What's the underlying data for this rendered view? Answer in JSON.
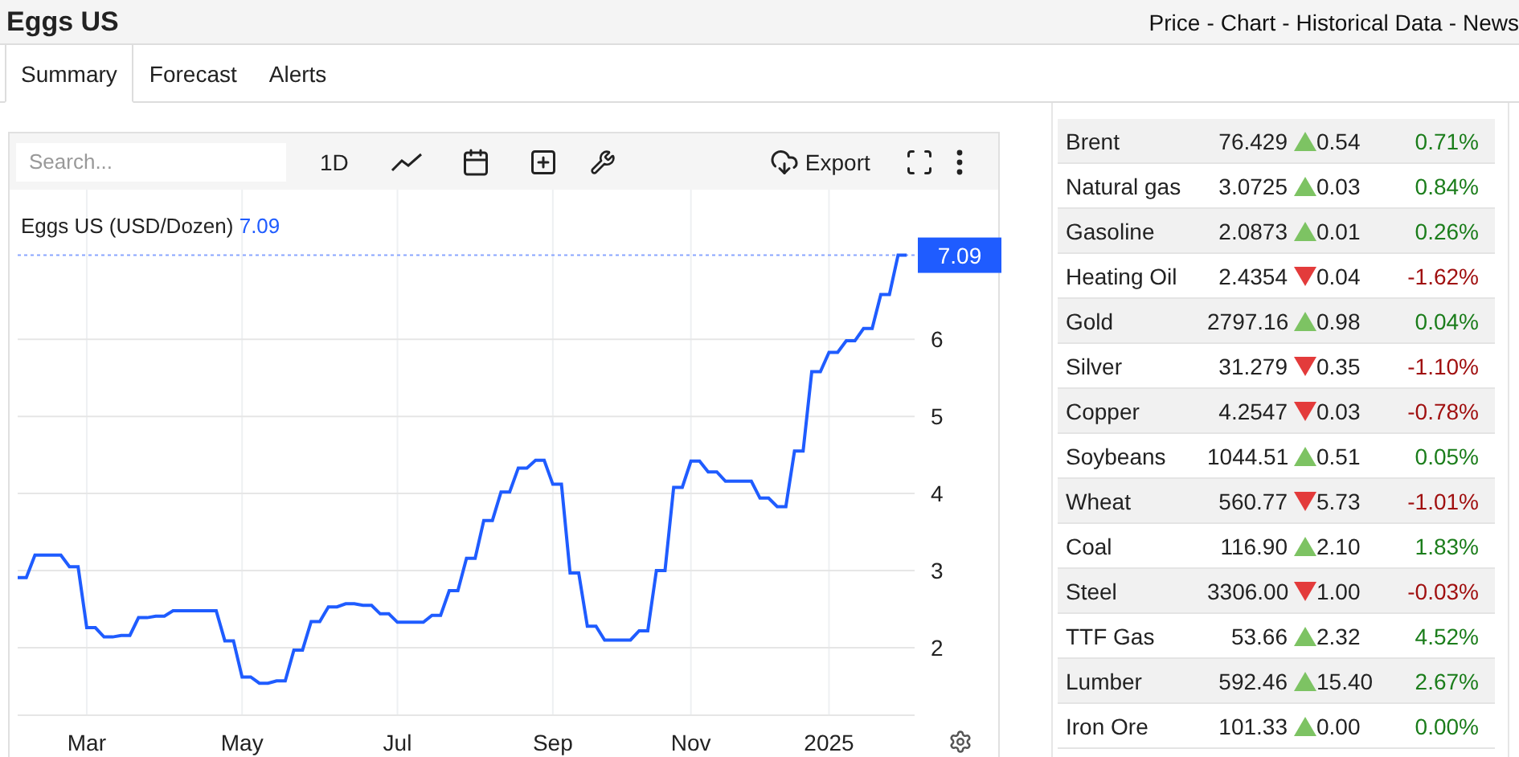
{
  "header": {
    "title": "Eggs US",
    "nav": [
      "Price",
      "Chart",
      "Historical Data",
      "News"
    ],
    "nav_separator": "-"
  },
  "tabs": [
    {
      "label": "Summary",
      "selected": true
    },
    {
      "label": "Forecast",
      "selected": false
    },
    {
      "label": "Alerts",
      "selected": false
    }
  ],
  "toolbar": {
    "search": {
      "placeholder": "Search..."
    },
    "interval": "1D",
    "export": "Export"
  },
  "chart": {
    "title": "Eggs US (USD/Dozen)",
    "title_value": "7.09",
    "last_value": "7.09",
    "chart_data": {
      "type": "line",
      "categories": [
        null,
        null,
        null,
        null,
        null,
        null,
        null,
        null,
        "Mar",
        null,
        null,
        null,
        null,
        null,
        null,
        null,
        null,
        null,
        null,
        null,
        null,
        null,
        null,
        null,
        null,
        null,
        "May",
        null,
        null,
        null,
        null,
        null,
        null,
        null,
        null,
        null,
        null,
        null,
        null,
        null,
        null,
        null,
        null,
        null,
        "Jul",
        null,
        null,
        null,
        null,
        null,
        null,
        null,
        null,
        null,
        null,
        null,
        null,
        null,
        null,
        null,
        null,
        null,
        "Sep",
        null,
        null,
        null,
        null,
        null,
        null,
        null,
        null,
        null,
        null,
        null,
        null,
        null,
        null,
        null,
        "Nov",
        null,
        null,
        null,
        null,
        null,
        null,
        null,
        null,
        null,
        null,
        null,
        null,
        null,
        null,
        null,
        "2025",
        null,
        null,
        null,
        null,
        null,
        null,
        null,
        null,
        null
      ],
      "series": [
        {
          "color": "#1f5cff",
          "values": [
            2.91,
            2.91,
            3.2,
            3.2,
            3.2,
            3.2,
            3.05,
            3.05,
            2.26,
            2.26,
            2.14,
            2.14,
            2.16,
            2.16,
            2.39,
            2.39,
            2.41,
            2.41,
            2.48,
            2.48,
            2.48,
            2.48,
            2.48,
            2.48,
            2.09,
            2.09,
            1.62,
            1.62,
            1.54,
            1.54,
            1.57,
            1.57,
            1.97,
            1.97,
            2.34,
            2.34,
            2.53,
            2.53,
            2.57,
            2.57,
            2.55,
            2.55,
            2.44,
            2.44,
            2.33,
            2.33,
            2.33,
            2.33,
            2.42,
            2.42,
            2.74,
            2.74,
            3.16,
            3.16,
            3.65,
            3.65,
            4.02,
            4.02,
            4.33,
            4.33,
            4.43,
            4.43,
            4.12,
            4.12,
            2.97,
            2.97,
            2.28,
            2.28,
            2.1,
            2.1,
            2.1,
            2.1,
            2.22,
            2.22,
            3.0,
            3.0,
            4.08,
            4.08,
            4.42,
            4.42,
            4.28,
            4.28,
            4.16,
            4.16,
            4.16,
            4.16,
            3.94,
            3.94,
            3.83,
            3.83,
            4.55,
            4.55,
            5.58,
            5.58,
            5.83,
            5.83,
            5.98,
            5.98,
            6.14,
            6.14,
            6.58,
            6.58,
            7.09,
            7.09
          ]
        }
      ],
      "grid": true,
      "ref_lines": [
        {
          "axis": "y",
          "value": 7.09
        }
      ],
      "ylim": [
        1.125,
        7.94
      ],
      "yticks": [
        2,
        3,
        4,
        5,
        6
      ]
    }
  },
  "commodities": [
    {
      "name": "Brent",
      "price": "76.429",
      "kind": "up",
      "change": "0.54",
      "percent": "0.71%"
    },
    {
      "name": "Natural gas",
      "price": "3.0725",
      "kind": "up",
      "change": "0.03",
      "percent": "0.84%"
    },
    {
      "name": "Gasoline",
      "price": "2.0873",
      "kind": "up",
      "change": "0.01",
      "percent": "0.26%"
    },
    {
      "name": "Heating Oil",
      "price": "2.4354",
      "kind": "down",
      "change": "0.04",
      "percent": "-1.62%"
    },
    {
      "name": "Gold",
      "price": "2797.16",
      "kind": "up",
      "change": "0.98",
      "percent": "0.04%"
    },
    {
      "name": "Silver",
      "price": "31.279",
      "kind": "down",
      "change": "0.35",
      "percent": "-1.10%"
    },
    {
      "name": "Copper",
      "price": "4.2547",
      "kind": "down",
      "change": "0.03",
      "percent": "-0.78%"
    },
    {
      "name": "Soybeans",
      "price": "1044.51",
      "kind": "up",
      "change": "0.51",
      "percent": "0.05%"
    },
    {
      "name": "Wheat",
      "price": "560.77",
      "kind": "down",
      "change": "5.73",
      "percent": "-1.01%"
    },
    {
      "name": "Coal",
      "price": "116.90",
      "kind": "up",
      "change": "2.10",
      "percent": "1.83%"
    },
    {
      "name": "Steel",
      "price": "3306.00",
      "kind": "down",
      "change": "1.00",
      "percent": "-0.03%"
    },
    {
      "name": "TTF Gas",
      "price": "53.66",
      "kind": "up",
      "change": "2.32",
      "percent": "4.52%"
    },
    {
      "name": "Lumber",
      "price": "592.46",
      "kind": "up",
      "change": "15.40",
      "percent": "2.67%"
    },
    {
      "name": "Iron Ore",
      "price": "101.33",
      "kind": "up",
      "change": "0.00",
      "percent": "0.00%"
    }
  ]
}
